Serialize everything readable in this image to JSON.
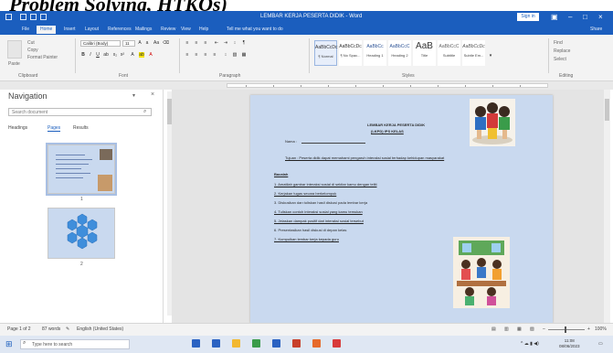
{
  "heading": {
    "text": "Problem Solving, HTKOs)"
  },
  "titlebar": {
    "title": "LEMBAR KERJA PESERTA DIDIK - Word",
    "sign_in": "Sign in"
  },
  "ribbon": {
    "tabs": [
      "File",
      "Home",
      "Insert",
      "Layout",
      "References",
      "Mailings",
      "Review",
      "View",
      "Help",
      "Tell me what you want to do"
    ],
    "share": "Share",
    "paste_label": "Paste",
    "cut_label": "Cut",
    "copy_label": "Copy",
    "format_painter_label": "Format Painter",
    "font_name": "Calibri (Body)",
    "font_size": "11",
    "group_labels": [
      "Clipboard",
      "Font",
      "Paragraph",
      "Styles",
      "Editing"
    ],
    "styles": [
      {
        "preview": "AaBbCcDc",
        "name": "¶ Normal"
      },
      {
        "preview": "AaBbCcDc",
        "name": "¶ No Spac..."
      },
      {
        "preview": "AaBbCc",
        "name": "Heading 1"
      },
      {
        "preview": "AaBbCcC",
        "name": "Heading 2"
      },
      {
        "preview": "AaB",
        "name": "Title"
      },
      {
        "preview": "AaBbCcC",
        "name": "Subtitle"
      },
      {
        "preview": "AaBbCcDc",
        "name": "Subtle Em..."
      }
    ],
    "editing": [
      "Find",
      "Replace",
      "Select"
    ]
  },
  "nav": {
    "title": "Navigation",
    "search_placeholder": "Search document",
    "tabs": [
      "Headings",
      "Pages",
      "Results"
    ],
    "page_numbers": [
      "1",
      "2"
    ]
  },
  "document": {
    "title_line1": "LEMBAR KERJA PESERTA DIDIK",
    "title_line2": "(LKPD) IPS KELAS",
    "name_field": "Nama :",
    "intro": "Tujuan : Peserta didik dapat memahami pengaruh interaksi sosial terhadap kehidupan masyarakat",
    "section": "Bacalah",
    "items": [
      "1. Amatilah gambar interaksi sosial di sekitar kamu dengan teliti",
      "2. Kerjakan tugas secara berkelompok",
      "3. Diskusikan dan tuliskan hasil diskusi pada lembar kerja",
      "4. Tuliskan contoh interaksi sosial yang kamu temukan",
      "5. Jelaskan dampak positif dari interaksi sosial tersebut",
      "6. Presentasikan hasil diskusi di depan kelas",
      "7. Kumpulkan lembar kerja kepada guru"
    ]
  },
  "status": {
    "page_info": "Page 1 of 2",
    "words": "87 words",
    "language": "English (United States)",
    "zoom": "100%"
  },
  "taskbar": {
    "search_placeholder": "Type here to search",
    "time": "11:08",
    "date": "08/06/2023"
  }
}
